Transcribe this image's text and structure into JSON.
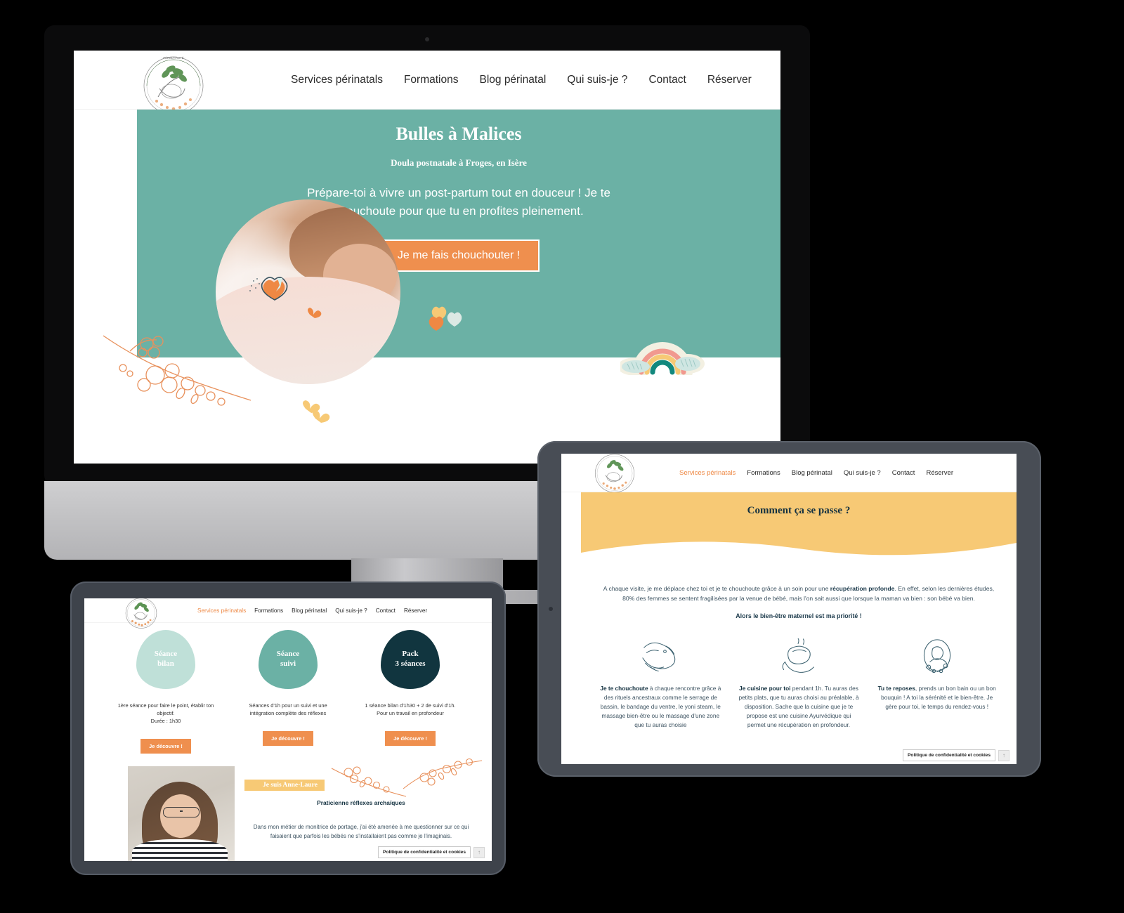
{
  "brand": {
    "name": "Bulles à Malices",
    "logo_text_top": "BULLES À MALICES · PÉRINATALITÉ BIENVEILLANTE",
    "colors": {
      "teal": "#6bb1a5",
      "orange": "#ef8f4e",
      "yellow": "#f7c975",
      "dark_teal": "#11353f",
      "light_mint": "#bfe0d8",
      "text_dark": "#2b2b2b"
    }
  },
  "nav": {
    "items": [
      {
        "label": "Services périnatals",
        "active": false
      },
      {
        "label": "Formations",
        "active": false
      },
      {
        "label": "Blog périnatal",
        "active": false
      },
      {
        "label": "Qui suis-je ?",
        "active": false
      },
      {
        "label": "Contact",
        "active": false
      },
      {
        "label": "Réserver",
        "active": false
      }
    ],
    "items_mobile": [
      {
        "label": "Services périnatals",
        "active": true
      },
      {
        "label": "Formations",
        "active": false
      },
      {
        "label": "Blog périnatal",
        "active": false
      },
      {
        "label": "Qui suis-je ?",
        "active": false
      },
      {
        "label": "Contact",
        "active": false
      },
      {
        "label": "Réserver",
        "active": false
      }
    ]
  },
  "desktop": {
    "hero": {
      "title": "Bulles à Malices",
      "subtitle": "Doula postnatale à Froges, en Isère",
      "paragraph": "Prépare-toi à vivre un post-partum tout en douceur ! Je te chouchoute pour que tu en profites pleinement.",
      "cta": "Je me fais chouchouter !"
    }
  },
  "tablet": {
    "section_title": "Comment ça se passe ?",
    "intro_part1": "A chaque visite, je me déplace chez toi et je te chouchoute grâce à un soin pour une ",
    "intro_bold": "récupération profonde",
    "intro_part2": ". En effet, selon les dernières études, 80% des femmes se sentent fragilisées par la venue de bébé, mais l'on sait aussi que lorsque la maman va bien : son bébé va bien.",
    "highlight": "Alors le bien-être maternel est ma priorité !",
    "columns": [
      {
        "icon": "hands-baby-icon",
        "bold": "Je te chouchoute",
        "text": " à chaque rencontre grâce à des rituels ancestraux comme le serrage de bassin, le bandage du ventre, le yoni steam, le massage bien-être ou le massage d'une zone que tu auras choisie"
      },
      {
        "icon": "hand-bowl-icon",
        "bold": "Je cuisine pour toi",
        "text": " pendant 1h. Tu auras des petits plats, que tu auras choisi au préalable, à disposition. Sache que la cuisine que je te propose est une cuisine Ayurvédique qui permet une récupération en profondeur."
      },
      {
        "icon": "woman-resting-icon",
        "bold": "Tu te reposes",
        "text": ", prends un bon bain ou un bon bouquin ! A toi la sérénité et le bien-être. Je gère pour toi, le temps du rendez-vous !"
      }
    ],
    "cookie_label": "Politique de confidentialité et cookies",
    "scroll_top_icon": "arrow-up-icon"
  },
  "laptop": {
    "cards": [
      {
        "title_line1": "Séance",
        "title_line2": "bilan",
        "color": "#bfe0d8",
        "desc": "1ère séance pour faire le point, établir ton objectif.\nDurée : 1h30",
        "button": "Je découvre !"
      },
      {
        "title_line1": "Séance",
        "title_line2": "suivi",
        "color": "#6bb1a5",
        "desc": "Séances d'1h pour un suivi et une intégration complète des réflexes",
        "button": "Je découvre !"
      },
      {
        "title_line1": "Pack",
        "title_line2": "3 séances",
        "color": "#11353f",
        "desc": "1 séance bilan d'1h30 + 2 de suivi d'1h. Pour un travail en profondeur",
        "button": "Je découvre !"
      }
    ],
    "about": {
      "badge": "Je suis Anne-Laure",
      "subtitle": "Praticienne réflexes archaïques",
      "body": "Dans mon métier de monitrice de portage, j'ai été amenée à me questionner sur ce qui faisaient que parfois les bébés ne s'installaient pas comme je l'imaginais.",
      "photo_alt": "portrait-anne-laure"
    },
    "cookie_label": "Politique de confidentialité et cookies",
    "scroll_top_icon": "arrow-up-icon"
  }
}
